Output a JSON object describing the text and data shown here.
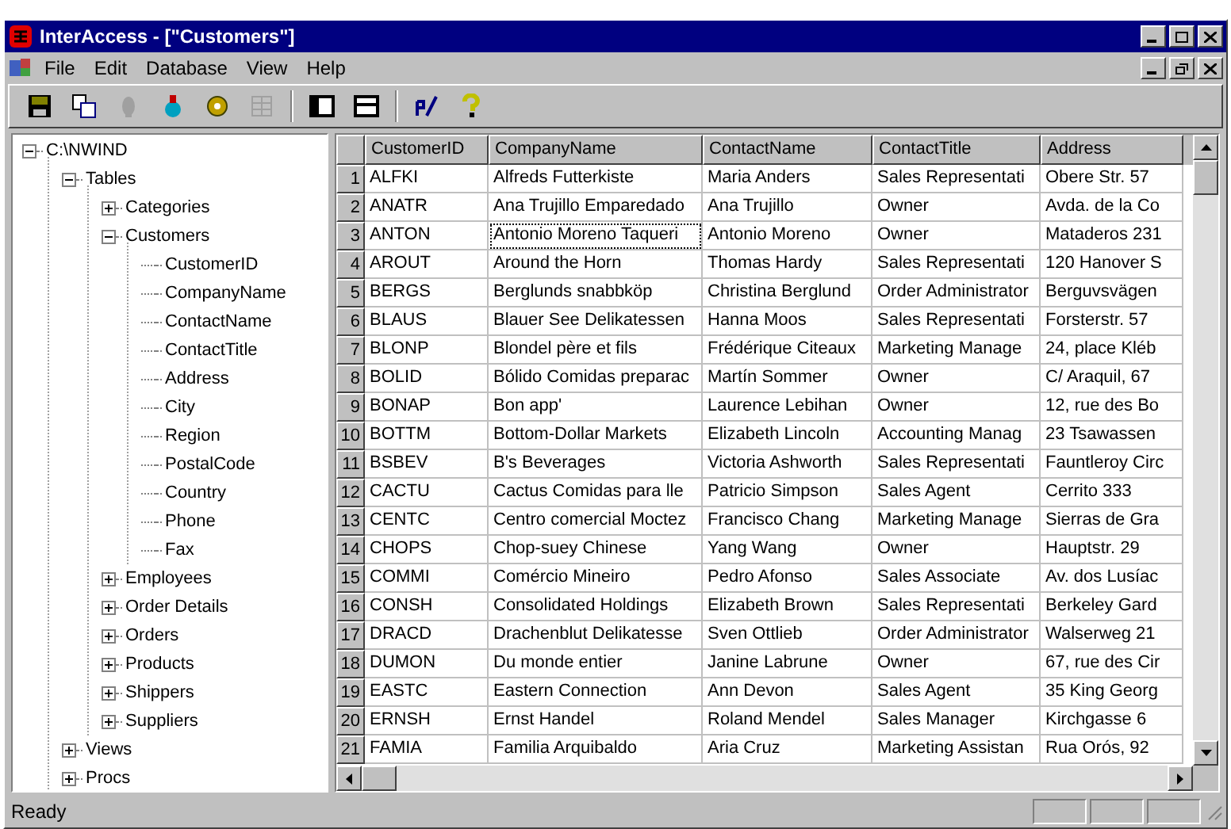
{
  "window": {
    "title": "InterAccess - [\"Customers\"]"
  },
  "menu": [
    "File",
    "Edit",
    "Database",
    "View",
    "Help"
  ],
  "toolbar": [
    {
      "kind": "save",
      "disabled": false
    },
    {
      "kind": "copy",
      "disabled": false
    },
    {
      "kind": "bulb",
      "disabled": true
    },
    {
      "kind": "run",
      "disabled": false
    },
    {
      "kind": "gear",
      "disabled": false
    },
    {
      "kind": "grid",
      "disabled": true
    },
    {
      "kind": "sep"
    },
    {
      "kind": "split-v",
      "disabled": false
    },
    {
      "kind": "split-h",
      "disabled": false
    },
    {
      "kind": "sep"
    },
    {
      "kind": "edit",
      "disabled": false
    },
    {
      "kind": "help",
      "disabled": false
    }
  ],
  "tree": [
    {
      "label": "C:\\NWIND",
      "expanded": true,
      "children": [
        {
          "label": "Tables",
          "expanded": true,
          "children": [
            {
              "label": "Categories",
              "expanded": false
            },
            {
              "label": "Customers",
              "expanded": true,
              "children": [
                {
                  "label": "CustomerID"
                },
                {
                  "label": "CompanyName"
                },
                {
                  "label": "ContactName"
                },
                {
                  "label": "ContactTitle"
                },
                {
                  "label": "Address"
                },
                {
                  "label": "City"
                },
                {
                  "label": "Region"
                },
                {
                  "label": "PostalCode"
                },
                {
                  "label": "Country"
                },
                {
                  "label": "Phone"
                },
                {
                  "label": "Fax"
                }
              ]
            },
            {
              "label": "Employees",
              "expanded": false
            },
            {
              "label": "Order Details",
              "expanded": false
            },
            {
              "label": "Orders",
              "expanded": false
            },
            {
              "label": "Products",
              "expanded": false
            },
            {
              "label": "Shippers",
              "expanded": false
            },
            {
              "label": "Suppliers",
              "expanded": false
            }
          ]
        },
        {
          "label": "Views",
          "expanded": false
        },
        {
          "label": "Procs",
          "expanded": false
        }
      ]
    }
  ],
  "table": {
    "columns": [
      "CustomerID",
      "CompanyName",
      "ContactName",
      "ContactTitle",
      "Address"
    ],
    "rows": [
      {
        "number": "1",
        "cells": [
          {
            "text": "ALFKI",
            "focused": false
          },
          {
            "text": "Alfreds Futterkiste",
            "focused": false
          },
          {
            "text": "Maria Anders",
            "focused": false
          },
          {
            "text": "Sales Representati",
            "focused": false
          },
          {
            "text": "Obere Str. 57",
            "focused": false
          }
        ]
      },
      {
        "number": "2",
        "cells": [
          {
            "text": "ANATR",
            "focused": false
          },
          {
            "text": "Ana Trujillo Emparedado",
            "focused": false
          },
          {
            "text": "Ana Trujillo",
            "focused": false
          },
          {
            "text": "Owner",
            "focused": false
          },
          {
            "text": "Avda. de la Co",
            "focused": false
          }
        ]
      },
      {
        "number": "3",
        "cells": [
          {
            "text": "ANTON",
            "focused": false
          },
          {
            "text": "Antonio Moreno Taqueri",
            "focused": true
          },
          {
            "text": "Antonio Moreno",
            "focused": false
          },
          {
            "text": "Owner",
            "focused": false
          },
          {
            "text": "Mataderos 231",
            "focused": false
          }
        ]
      },
      {
        "number": "4",
        "cells": [
          {
            "text": "AROUT",
            "focused": false
          },
          {
            "text": "Around the Horn",
            "focused": false
          },
          {
            "text": "Thomas Hardy",
            "focused": false
          },
          {
            "text": "Sales Representati",
            "focused": false
          },
          {
            "text": "120 Hanover S",
            "focused": false
          }
        ]
      },
      {
        "number": "5",
        "cells": [
          {
            "text": "BERGS",
            "focused": false
          },
          {
            "text": "Berglunds snabbköp",
            "focused": false
          },
          {
            "text": "Christina Berglund",
            "focused": false
          },
          {
            "text": "Order Administrator",
            "focused": false
          },
          {
            "text": "Berguvsvägen",
            "focused": false
          }
        ]
      },
      {
        "number": "6",
        "cells": [
          {
            "text": "BLAUS",
            "focused": false
          },
          {
            "text": "Blauer See Delikatessen",
            "focused": false
          },
          {
            "text": "Hanna Moos",
            "focused": false
          },
          {
            "text": "Sales Representati",
            "focused": false
          },
          {
            "text": "Forsterstr. 57",
            "focused": false
          }
        ]
      },
      {
        "number": "7",
        "cells": [
          {
            "text": "BLONP",
            "focused": false
          },
          {
            "text": "Blondel père et fils",
            "focused": false
          },
          {
            "text": "Frédérique Citeaux",
            "focused": false
          },
          {
            "text": "Marketing Manage",
            "focused": false
          },
          {
            "text": "24, place Kléb",
            "focused": false
          }
        ]
      },
      {
        "number": "8",
        "cells": [
          {
            "text": "BOLID",
            "focused": false
          },
          {
            "text": "Bólido Comidas preparac",
            "focused": false
          },
          {
            "text": "Martín Sommer",
            "focused": false
          },
          {
            "text": "Owner",
            "focused": false
          },
          {
            "text": "C/ Araquil, 67",
            "focused": false
          }
        ]
      },
      {
        "number": "9",
        "cells": [
          {
            "text": "BONAP",
            "focused": false
          },
          {
            "text": "Bon app'",
            "focused": false
          },
          {
            "text": "Laurence Lebihan",
            "focused": false
          },
          {
            "text": "Owner",
            "focused": false
          },
          {
            "text": "12, rue des Bo",
            "focused": false
          }
        ]
      },
      {
        "number": "10",
        "cells": [
          {
            "text": "BOTTM",
            "focused": false
          },
          {
            "text": "Bottom-Dollar Markets",
            "focused": false
          },
          {
            "text": "Elizabeth Lincoln",
            "focused": false
          },
          {
            "text": "Accounting Manag",
            "focused": false
          },
          {
            "text": "23 Tsawassen",
            "focused": false
          }
        ]
      },
      {
        "number": "11",
        "cells": [
          {
            "text": "BSBEV",
            "focused": false
          },
          {
            "text": "B's Beverages",
            "focused": false
          },
          {
            "text": "Victoria Ashworth",
            "focused": false
          },
          {
            "text": "Sales Representati",
            "focused": false
          },
          {
            "text": "Fauntleroy Circ",
            "focused": false
          }
        ]
      },
      {
        "number": "12",
        "cells": [
          {
            "text": "CACTU",
            "focused": false
          },
          {
            "text": "Cactus Comidas para lle",
            "focused": false
          },
          {
            "text": "Patricio Simpson",
            "focused": false
          },
          {
            "text": "Sales Agent",
            "focused": false
          },
          {
            "text": "Cerrito 333",
            "focused": false
          }
        ]
      },
      {
        "number": "13",
        "cells": [
          {
            "text": "CENTC",
            "focused": false
          },
          {
            "text": "Centro comercial Moctez",
            "focused": false
          },
          {
            "text": "Francisco Chang",
            "focused": false
          },
          {
            "text": "Marketing Manage",
            "focused": false
          },
          {
            "text": "Sierras de Gra",
            "focused": false
          }
        ]
      },
      {
        "number": "14",
        "cells": [
          {
            "text": "CHOPS",
            "focused": false
          },
          {
            "text": "Chop-suey Chinese",
            "focused": false
          },
          {
            "text": "Yang Wang",
            "focused": false
          },
          {
            "text": "Owner",
            "focused": false
          },
          {
            "text": "Hauptstr. 29",
            "focused": false
          }
        ]
      },
      {
        "number": "15",
        "cells": [
          {
            "text": "COMMI",
            "focused": false
          },
          {
            "text": "Comércio Mineiro",
            "focused": false
          },
          {
            "text": "Pedro Afonso",
            "focused": false
          },
          {
            "text": "Sales Associate",
            "focused": false
          },
          {
            "text": "Av. dos Lusíac",
            "focused": false
          }
        ]
      },
      {
        "number": "16",
        "cells": [
          {
            "text": "CONSH",
            "focused": false
          },
          {
            "text": "Consolidated Holdings",
            "focused": false
          },
          {
            "text": "Elizabeth Brown",
            "focused": false
          },
          {
            "text": "Sales Representati",
            "focused": false
          },
          {
            "text": "Berkeley Gard",
            "focused": false
          }
        ]
      },
      {
        "number": "17",
        "cells": [
          {
            "text": "DRACD",
            "focused": false
          },
          {
            "text": "Drachenblut Delikatesse",
            "focused": false
          },
          {
            "text": "Sven Ottlieb",
            "focused": false
          },
          {
            "text": "Order Administrator",
            "focused": false
          },
          {
            "text": "Walserweg 21",
            "focused": false
          }
        ]
      },
      {
        "number": "18",
        "cells": [
          {
            "text": "DUMON",
            "focused": false
          },
          {
            "text": "Du monde entier",
            "focused": false
          },
          {
            "text": "Janine Labrune",
            "focused": false
          },
          {
            "text": "Owner",
            "focused": false
          },
          {
            "text": "67, rue des Cir",
            "focused": false
          }
        ]
      },
      {
        "number": "19",
        "cells": [
          {
            "text": "EASTC",
            "focused": false
          },
          {
            "text": "Eastern Connection",
            "focused": false
          },
          {
            "text": "Ann Devon",
            "focused": false
          },
          {
            "text": "Sales Agent",
            "focused": false
          },
          {
            "text": "35 King Georg",
            "focused": false
          }
        ]
      },
      {
        "number": "20",
        "cells": [
          {
            "text": "ERNSH",
            "focused": false
          },
          {
            "text": "Ernst Handel",
            "focused": false
          },
          {
            "text": "Roland Mendel",
            "focused": false
          },
          {
            "text": "Sales Manager",
            "focused": false
          },
          {
            "text": "Kirchgasse 6",
            "focused": false
          }
        ]
      },
      {
        "number": "21",
        "cells": [
          {
            "text": "FAMIA",
            "focused": false
          },
          {
            "text": "Familia Arquibaldo",
            "focused": false
          },
          {
            "text": "Aria Cruz",
            "focused": false
          },
          {
            "text": "Marketing Assistan",
            "focused": false
          },
          {
            "text": "Rua Orós, 92",
            "focused": false
          }
        ]
      }
    ]
  },
  "status_bar": {
    "text": "Ready"
  }
}
